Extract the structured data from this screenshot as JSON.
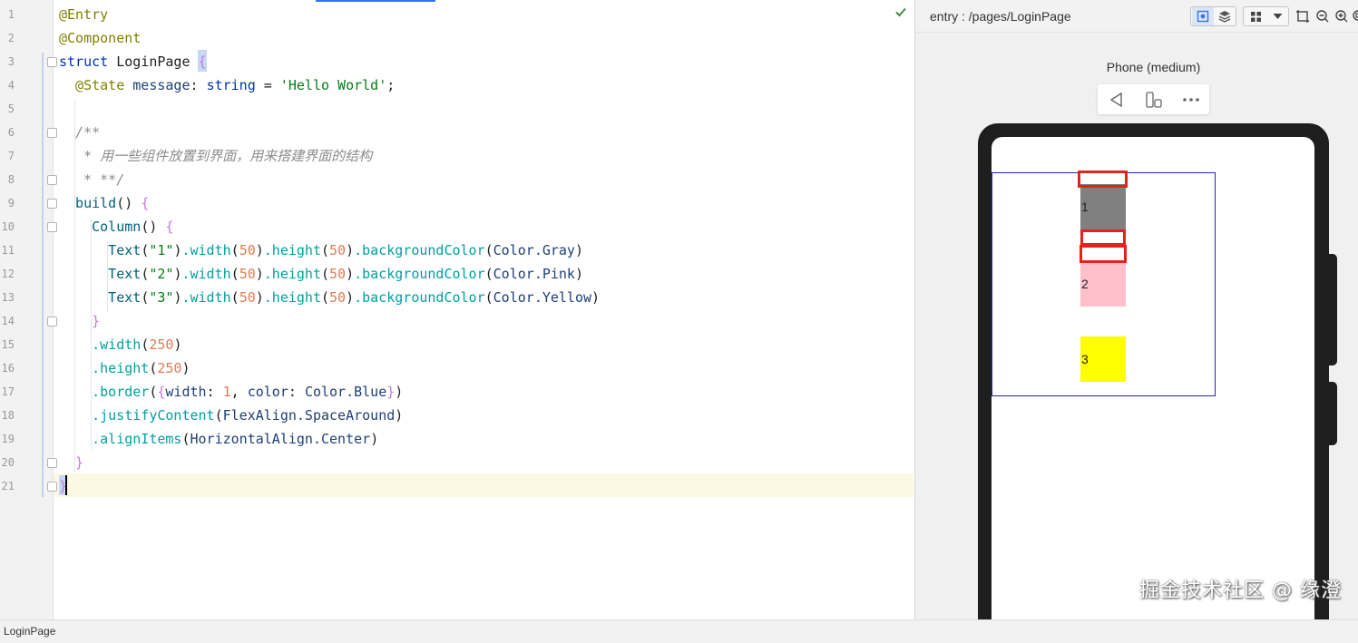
{
  "editor": {
    "line_numbers": [
      "1",
      "2",
      "3",
      "4",
      "5",
      "6",
      "7",
      "8",
      "9",
      "10",
      "11",
      "12",
      "13",
      "14",
      "15",
      "16",
      "17",
      "18",
      "19",
      "20",
      "21"
    ],
    "lines": [
      [
        [
          "@Entry",
          "t-ann"
        ]
      ],
      [
        [
          "@Component",
          "t-ann"
        ]
      ],
      [
        [
          "struct ",
          "t-kw"
        ],
        [
          "LoginPage ",
          "t-type"
        ],
        [
          "{",
          "t-brace"
        ]
      ],
      [
        [
          "  @State ",
          "t-ann"
        ],
        [
          "message",
          "t-field"
        ],
        [
          ": ",
          "t-punc"
        ],
        [
          "string",
          "t-kw"
        ],
        [
          " = ",
          "t-punc"
        ],
        [
          "'Hello World'",
          "t-str"
        ],
        [
          ";",
          "t-punc"
        ]
      ],
      [],
      [
        [
          "  /**",
          "t-cmt"
        ]
      ],
      [
        [
          "   * 用一些组件放置到界面，用来搭建界面的结构",
          "t-cmt"
        ]
      ],
      [
        [
          "   * **/",
          "t-cmt"
        ]
      ],
      [
        [
          "  build",
          "t-fn"
        ],
        [
          "() ",
          "t-punc"
        ],
        [
          "{",
          "t-brace"
        ]
      ],
      [
        [
          "    Column",
          "t-fn"
        ],
        [
          "() ",
          "t-punc"
        ],
        [
          "{",
          "t-brace"
        ]
      ],
      [
        [
          "      Text",
          "t-fn"
        ],
        [
          "(",
          "t-punc"
        ],
        [
          "\"1\"",
          "t-str"
        ],
        [
          ")",
          "t-punc"
        ],
        [
          ".width",
          "t-teal"
        ],
        [
          "(",
          "t-punc"
        ],
        [
          "50",
          "t-num"
        ],
        [
          ")",
          "t-punc"
        ],
        [
          ".height",
          "t-teal"
        ],
        [
          "(",
          "t-punc"
        ],
        [
          "50",
          "t-num"
        ],
        [
          ")",
          "t-punc"
        ],
        [
          ".backgroundColor",
          "t-teal"
        ],
        [
          "(",
          "t-punc"
        ],
        [
          "Color",
          "t-field"
        ],
        [
          ".Gray",
          "t-field"
        ],
        [
          ")",
          "t-punc"
        ]
      ],
      [
        [
          "      Text",
          "t-fn"
        ],
        [
          "(",
          "t-punc"
        ],
        [
          "\"2\"",
          "t-str"
        ],
        [
          ")",
          "t-punc"
        ],
        [
          ".width",
          "t-teal"
        ],
        [
          "(",
          "t-punc"
        ],
        [
          "50",
          "t-num"
        ],
        [
          ")",
          "t-punc"
        ],
        [
          ".height",
          "t-teal"
        ],
        [
          "(",
          "t-punc"
        ],
        [
          "50",
          "t-num"
        ],
        [
          ")",
          "t-punc"
        ],
        [
          ".backgroundColor",
          "t-teal"
        ],
        [
          "(",
          "t-punc"
        ],
        [
          "Color",
          "t-field"
        ],
        [
          ".Pink",
          "t-field"
        ],
        [
          ")",
          "t-punc"
        ]
      ],
      [
        [
          "      Text",
          "t-fn"
        ],
        [
          "(",
          "t-punc"
        ],
        [
          "\"3\"",
          "t-str"
        ],
        [
          ")",
          "t-punc"
        ],
        [
          ".width",
          "t-teal"
        ],
        [
          "(",
          "t-punc"
        ],
        [
          "50",
          "t-num"
        ],
        [
          ")",
          "t-punc"
        ],
        [
          ".height",
          "t-teal"
        ],
        [
          "(",
          "t-punc"
        ],
        [
          "50",
          "t-num"
        ],
        [
          ")",
          "t-punc"
        ],
        [
          ".backgroundColor",
          "t-teal"
        ],
        [
          "(",
          "t-punc"
        ],
        [
          "Color",
          "t-field"
        ],
        [
          ".Yellow",
          "t-field"
        ],
        [
          ")",
          "t-punc"
        ]
      ],
      [
        [
          "    }",
          "t-brace"
        ]
      ],
      [
        [
          "    .width",
          "t-teal"
        ],
        [
          "(",
          "t-punc"
        ],
        [
          "250",
          "t-num"
        ],
        [
          ")",
          "t-punc"
        ]
      ],
      [
        [
          "    .height",
          "t-teal"
        ],
        [
          "(",
          "t-punc"
        ],
        [
          "250",
          "t-num"
        ],
        [
          ")",
          "t-punc"
        ]
      ],
      [
        [
          "    .border",
          "t-teal"
        ],
        [
          "(",
          "t-punc"
        ],
        [
          "{",
          "t-brace"
        ],
        [
          "width",
          "t-field"
        ],
        [
          ": ",
          "t-punc"
        ],
        [
          "1",
          "t-num"
        ],
        [
          ", ",
          "t-punc"
        ],
        [
          "color",
          "t-field"
        ],
        [
          ": ",
          "t-punc"
        ],
        [
          "Color",
          "t-field"
        ],
        [
          ".Blue",
          "t-field"
        ],
        [
          "}",
          "t-brace"
        ],
        [
          ")",
          "t-punc"
        ]
      ],
      [
        [
          "    .justifyContent",
          "t-teal"
        ],
        [
          "(",
          "t-punc"
        ],
        [
          "FlexAlign",
          "t-field"
        ],
        [
          ".SpaceAround",
          "t-field"
        ],
        [
          ")",
          "t-punc"
        ]
      ],
      [
        [
          "    .alignItems",
          "t-teal"
        ],
        [
          "(",
          "t-punc"
        ],
        [
          "HorizontalAlign",
          "t-field"
        ],
        [
          ".Center",
          "t-field"
        ],
        [
          ")",
          "t-punc"
        ]
      ],
      [
        [
          "  }",
          "t-brace"
        ]
      ],
      [
        [
          "}",
          "t-brace"
        ]
      ]
    ]
  },
  "status_bar": {
    "file": "LoginPage"
  },
  "previewer": {
    "title": "entry : /pages/LoginPage",
    "device_name": "Phone (medium)",
    "toolbar_icons": [
      "inspector-icon",
      "layers-icon",
      "grid-icon",
      "dropdown-icon",
      "crop-icon",
      "zoom-out-icon",
      "zoom-in-icon",
      "zoom-reset-icon"
    ],
    "device_controls": [
      "back-icon",
      "rotate-icon",
      "more-icon"
    ]
  },
  "preview_app": {
    "column": {
      "width": 250,
      "height": 250,
      "border_color": "#1f2a9a"
    },
    "texts": [
      {
        "label": "1",
        "color": "#808080"
      },
      {
        "label": "2",
        "color": "#ffc0cb"
      },
      {
        "label": "3",
        "color": "#ffff00"
      }
    ]
  },
  "watermark": "掘金技术社区 @ 缘澄",
  "colors": {
    "accent": "#3574f0",
    "highlight": "#e3231b",
    "check": "#3f9142"
  }
}
